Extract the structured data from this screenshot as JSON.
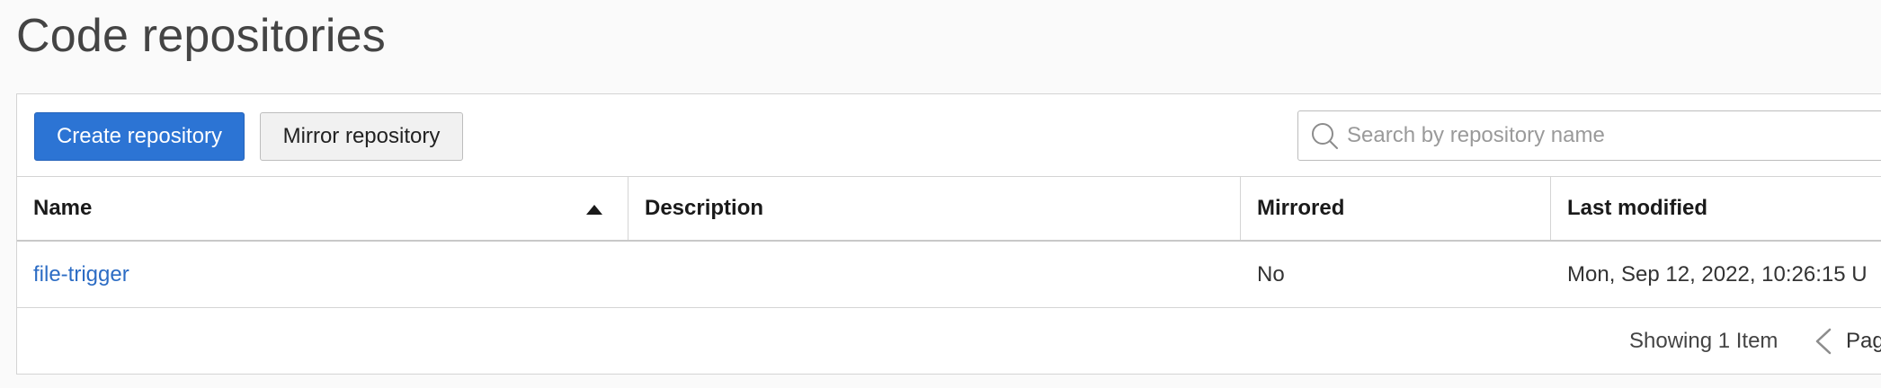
{
  "page": {
    "title": "Code repositories"
  },
  "toolbar": {
    "create_label": "Create repository",
    "mirror_label": "Mirror repository"
  },
  "search": {
    "placeholder": "Search by repository name",
    "value": "",
    "icon": "search-icon"
  },
  "table": {
    "columns": [
      {
        "label": "Name",
        "sorted": "ascending"
      },
      {
        "label": "Description"
      },
      {
        "label": "Mirrored"
      },
      {
        "label": "Last modified"
      }
    ],
    "rows": [
      {
        "name": "file-trigger",
        "description": "",
        "mirrored": "No",
        "last_modified": "Mon, Sep 12, 2022, 10:26:15 U"
      }
    ]
  },
  "pagination": {
    "showing_text": "Showing 1 Item",
    "page_label": "Pag",
    "prev_icon": "chevron-left-icon"
  },
  "colors": {
    "primary": "#2c74d4",
    "link": "#2c6cc4",
    "background": "#fafafa"
  }
}
